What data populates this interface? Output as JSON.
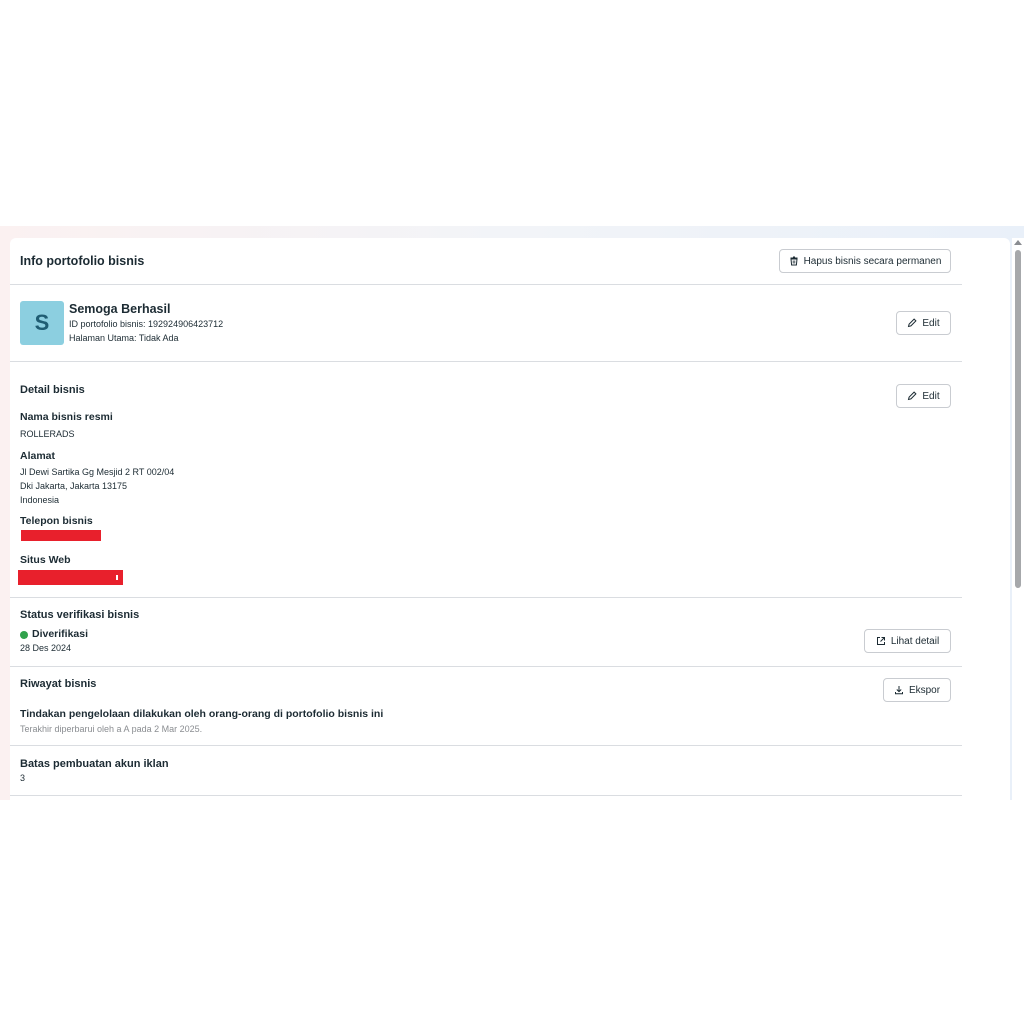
{
  "header": {
    "title": "Info portofolio bisnis",
    "delete_button": "Hapus bisnis secara permanen"
  },
  "profile": {
    "avatar_letter": "S",
    "name": "Semoga Berhasil",
    "id_line": "ID portofolio bisnis: 192924906423712",
    "homepage_line": "Halaman Utama: Tidak Ada",
    "edit_button": "Edit"
  },
  "details": {
    "title": "Detail bisnis",
    "edit_button": "Edit",
    "legal_name_label": "Nama bisnis resmi",
    "legal_name_value": "ROLLERADS",
    "address_label": "Alamat",
    "address_lines": [
      "Jl Dewi Sartika Gg Mesjid 2 RT 002/04",
      "Dki Jakarta, Jakarta 13175",
      "Indonesia"
    ],
    "phone_label": "Telepon bisnis",
    "website_label": "Situs Web"
  },
  "verification": {
    "title": "Status verifikasi bisnis",
    "status": "Diverifikasi",
    "date": "28 Des 2024",
    "detail_button": "Lihat detail",
    "status_color": "#31a24c"
  },
  "history": {
    "title": "Riwayat bisnis",
    "export_button": "Ekspor",
    "description": "Tindakan pengelolaan dilakukan oleh orang-orang di portofolio bisnis ini",
    "updated": "Terakhir diperbarui oleh a A pada 2 Mar 2025."
  },
  "ad_limit": {
    "title": "Batas pembuatan akun iklan",
    "value": "3"
  },
  "colors": {
    "redaction": "#e8202c",
    "avatar_bg": "#8ccfe0",
    "divider": "#dadde1"
  }
}
